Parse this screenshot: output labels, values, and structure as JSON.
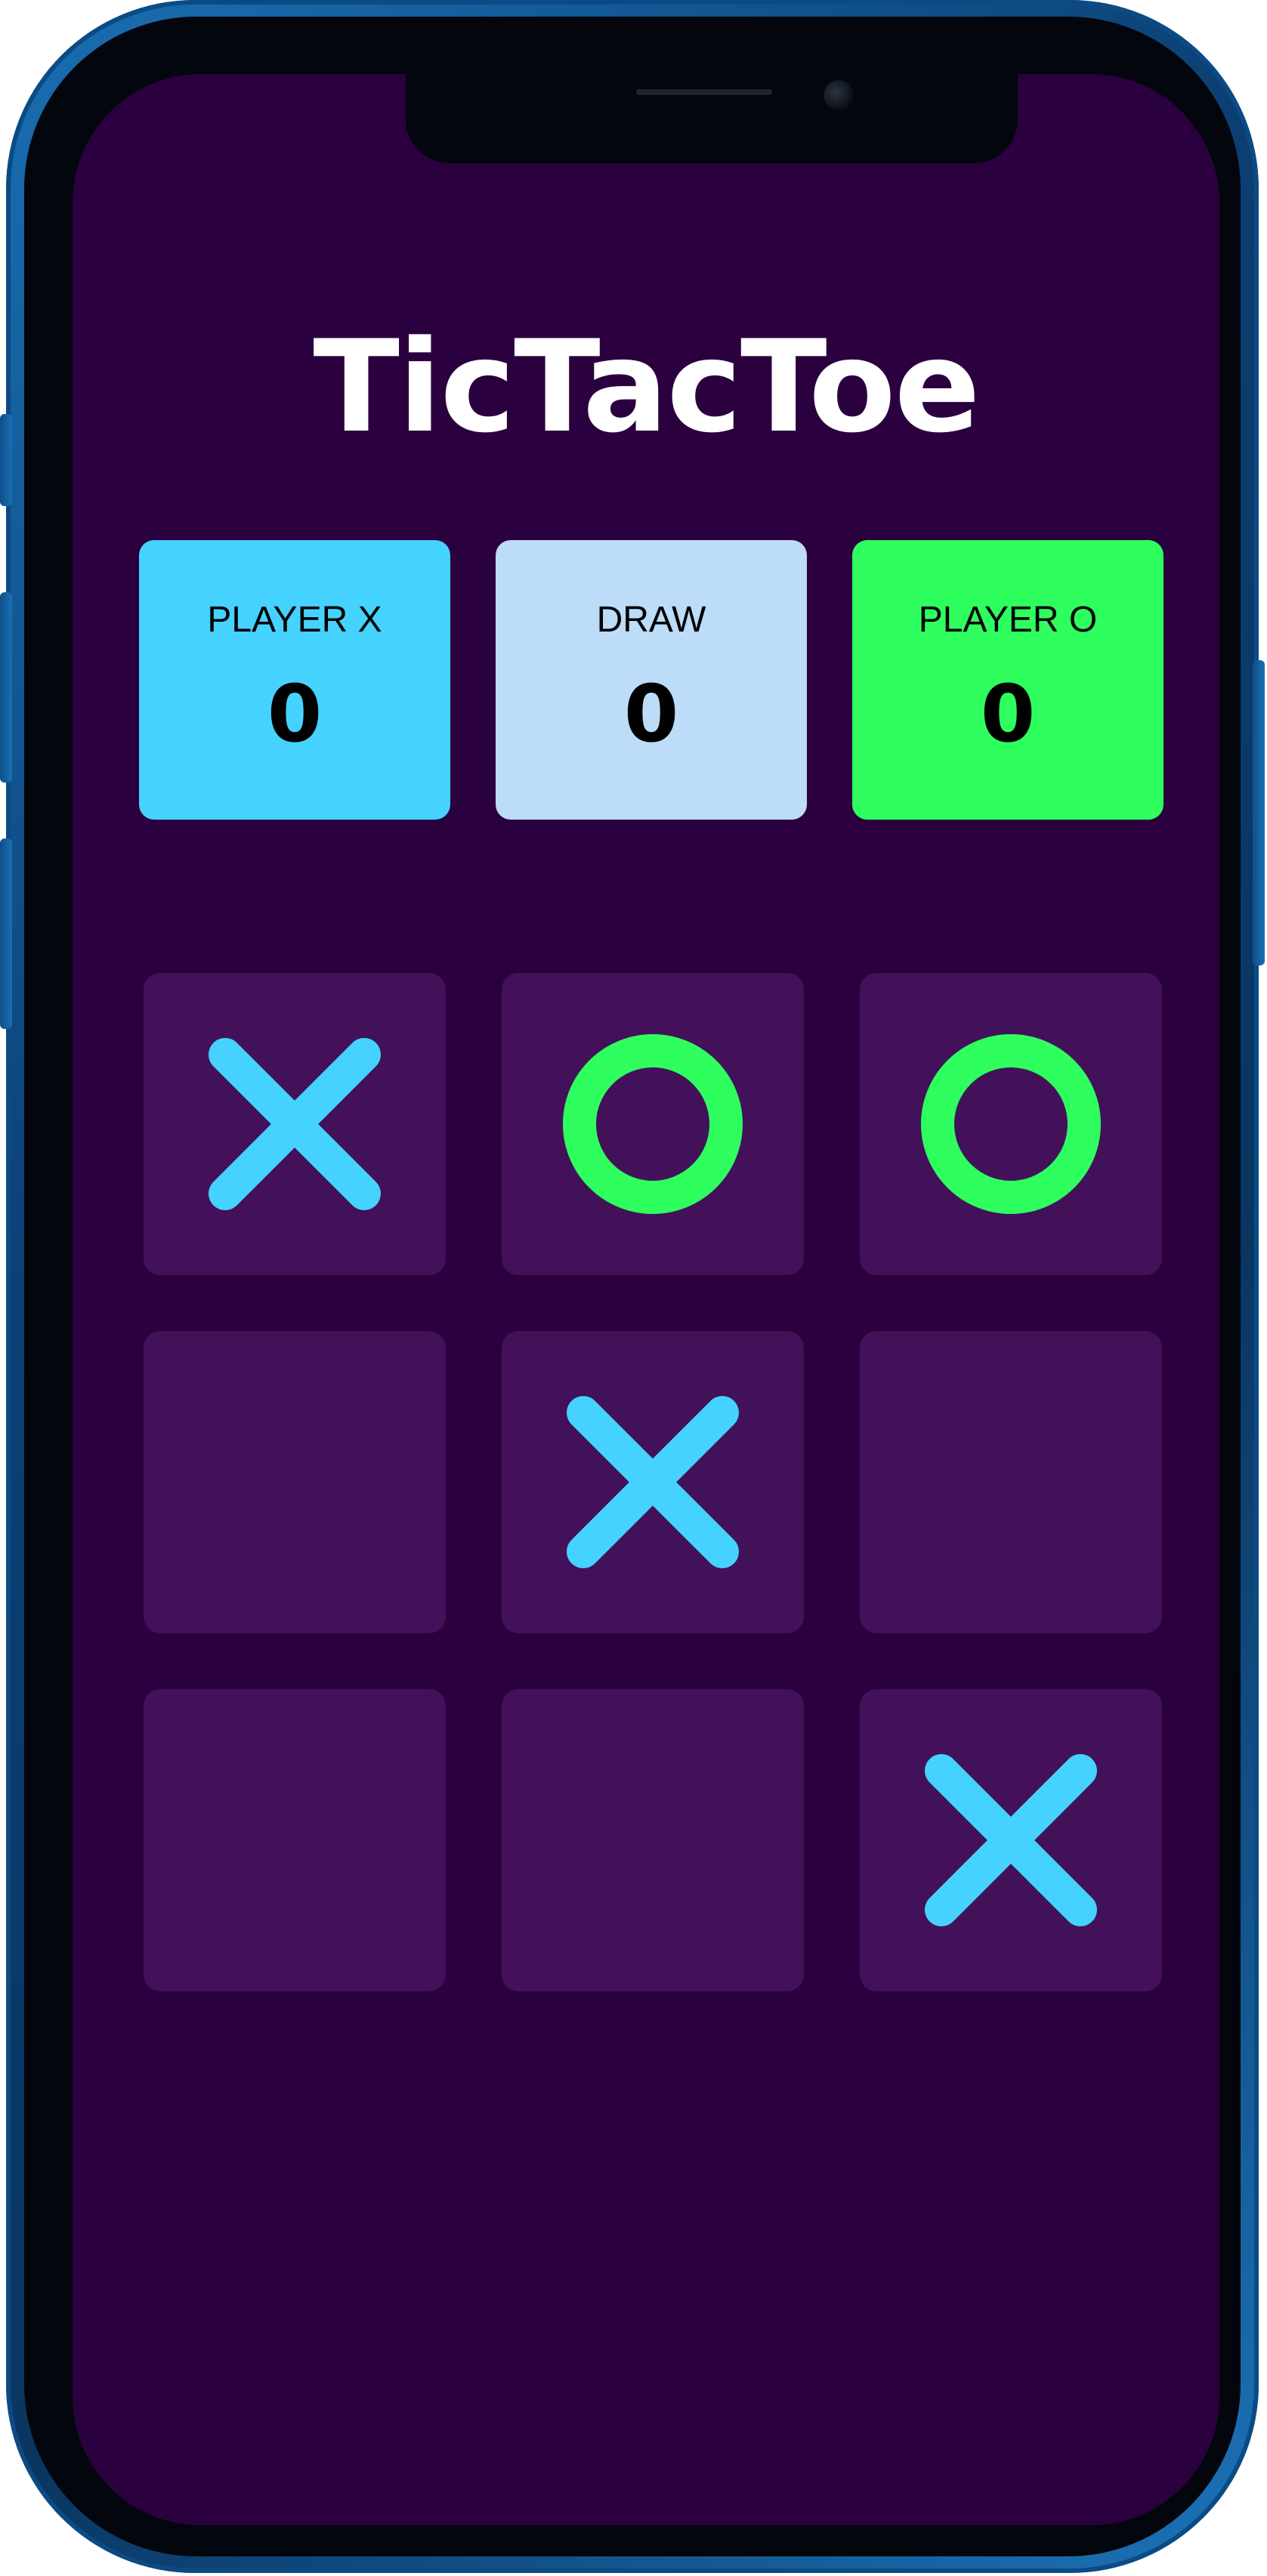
{
  "app": {
    "title": "TicTacToe"
  },
  "scoreboard": [
    {
      "label": "PLAYER X",
      "value": "0",
      "color": "#46d2ff"
    },
    {
      "label": "DRAW",
      "value": "0",
      "color": "#bcdcf7"
    },
    {
      "label": "PLAYER O",
      "value": "0",
      "color": "#2eff5e"
    }
  ],
  "board": {
    "cells": [
      "X",
      "O",
      "O",
      "",
      "X",
      "",
      "",
      "",
      "X"
    ],
    "colors": {
      "background": "#2b003e",
      "cell": "#42115a",
      "x_mark": "#46d2ff",
      "o_mark": "#2eff5e"
    },
    "icons": {
      "x": "x-mark-icon",
      "o": "o-mark-icon"
    }
  }
}
